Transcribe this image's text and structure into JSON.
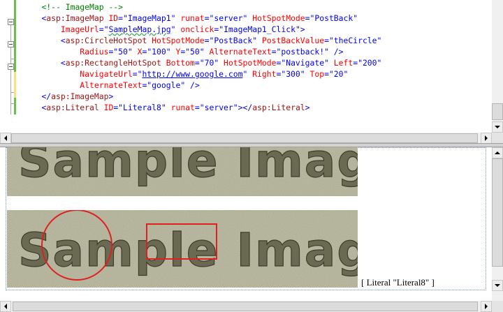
{
  "editor": {
    "lines": [
      {
        "indent": "    ",
        "tokens": [
          {
            "t": "<!-- ImageMap -->",
            "c": "tk-c"
          }
        ]
      },
      {
        "indent": "    ",
        "tokens": [
          {
            "t": "<",
            "c": "tk-b"
          },
          {
            "t": "asp:ImageMap",
            "c": "tk-t"
          },
          {
            "t": " ID",
            "c": "tk-a"
          },
          {
            "t": "=\"ImageMap1\"",
            "c": "tk-v"
          },
          {
            "t": " runat",
            "c": "tk-a"
          },
          {
            "t": "=\"server\"",
            "c": "tk-v"
          },
          {
            "t": " HotSpotMode",
            "c": "tk-a"
          },
          {
            "t": "=\"PostBack\"",
            "c": "tk-v"
          }
        ]
      },
      {
        "indent": "        ",
        "tokens": [
          {
            "t": "ImageUrl",
            "c": "tk-a"
          },
          {
            "t": "=\"",
            "c": "tk-v"
          },
          {
            "t": "SampleMap.jpg",
            "c": "tk-v tk-sq"
          },
          {
            "t": "\"",
            "c": "tk-v"
          },
          {
            "t": " onclick",
            "c": "tk-a"
          },
          {
            "t": "=\"ImageMap1_Click\">",
            "c": "tk-v"
          }
        ]
      },
      {
        "indent": "        ",
        "tokens": [
          {
            "t": "<",
            "c": "tk-b"
          },
          {
            "t": "asp:CircleHotSpot",
            "c": "tk-t"
          },
          {
            "t": " HotSpotMode",
            "c": "tk-a"
          },
          {
            "t": "=\"PostBack\"",
            "c": "tk-v"
          },
          {
            "t": " PostBackValue",
            "c": "tk-a"
          },
          {
            "t": "=\"theCircle\"",
            "c": "tk-v"
          }
        ]
      },
      {
        "indent": "            ",
        "tokens": [
          {
            "t": "Radius",
            "c": "tk-a"
          },
          {
            "t": "=\"50\"",
            "c": "tk-v"
          },
          {
            "t": " X",
            "c": "tk-a"
          },
          {
            "t": "=\"100\"",
            "c": "tk-v"
          },
          {
            "t": " Y",
            "c": "tk-a"
          },
          {
            "t": "=\"50\"",
            "c": "tk-v"
          },
          {
            "t": " AlternateText",
            "c": "tk-a"
          },
          {
            "t": "=\"postback!\"",
            "c": "tk-v"
          },
          {
            "t": " />",
            "c": "tk-b"
          }
        ]
      },
      {
        "indent": "        ",
        "tokens": [
          {
            "t": "<",
            "c": "tk-b"
          },
          {
            "t": "asp:RectangleHotSpot",
            "c": "tk-t"
          },
          {
            "t": " Bottom",
            "c": "tk-a"
          },
          {
            "t": "=\"70\"",
            "c": "tk-v"
          },
          {
            "t": " HotSpotMode",
            "c": "tk-a"
          },
          {
            "t": "=\"Navigate\"",
            "c": "tk-v"
          },
          {
            "t": " Left",
            "c": "tk-a"
          },
          {
            "t": "=\"200\"",
            "c": "tk-v"
          }
        ]
      },
      {
        "indent": "            ",
        "tokens": [
          {
            "t": "NavigateUrl",
            "c": "tk-a"
          },
          {
            "t": "=\"",
            "c": "tk-v"
          },
          {
            "t": "http://www.google.com",
            "c": "tk-link"
          },
          {
            "t": "\"",
            "c": "tk-v"
          },
          {
            "t": " Right",
            "c": "tk-a"
          },
          {
            "t": "=\"300\"",
            "c": "tk-v"
          },
          {
            "t": " Top",
            "c": "tk-a"
          },
          {
            "t": "=\"20\"",
            "c": "tk-v"
          }
        ]
      },
      {
        "indent": "            ",
        "tokens": [
          {
            "t": "AlternateText",
            "c": "tk-a"
          },
          {
            "t": "=\"google\"",
            "c": "tk-v"
          },
          {
            "t": " />",
            "c": "tk-b"
          }
        ]
      },
      {
        "indent": "    ",
        "tokens": [
          {
            "t": "</",
            "c": "tk-b"
          },
          {
            "t": "asp:ImageMap",
            "c": "tk-t"
          },
          {
            "t": ">",
            "c": "tk-b"
          }
        ]
      },
      {
        "indent": "    ",
        "tokens": [
          {
            "t": "<",
            "c": "tk-b"
          },
          {
            "t": "asp:Literal",
            "c": "tk-t"
          },
          {
            "t": " ID",
            "c": "tk-a"
          },
          {
            "t": "=\"Literal8\"",
            "c": "tk-v"
          },
          {
            "t": " runat",
            "c": "tk-a"
          },
          {
            "t": "=\"server\"",
            "c": "tk-v"
          },
          {
            "t": "></",
            "c": "tk-b"
          },
          {
            "t": "asp:Literal",
            "c": "tk-t"
          },
          {
            "t": ">",
            "c": "tk-b"
          }
        ]
      }
    ]
  },
  "design": {
    "image_text": "Sample Image",
    "literal_label": "[ Literal \"Literal8\" ]"
  },
  "colors": {
    "hotspot": "#e02020",
    "change_yellow": "#f7e27c",
    "change_green": "#6cc04a"
  },
  "icons": [
    "collapse-icon",
    "scroll-up-icon",
    "scroll-down-icon",
    "scroll-left-icon",
    "scroll-right-icon"
  ]
}
